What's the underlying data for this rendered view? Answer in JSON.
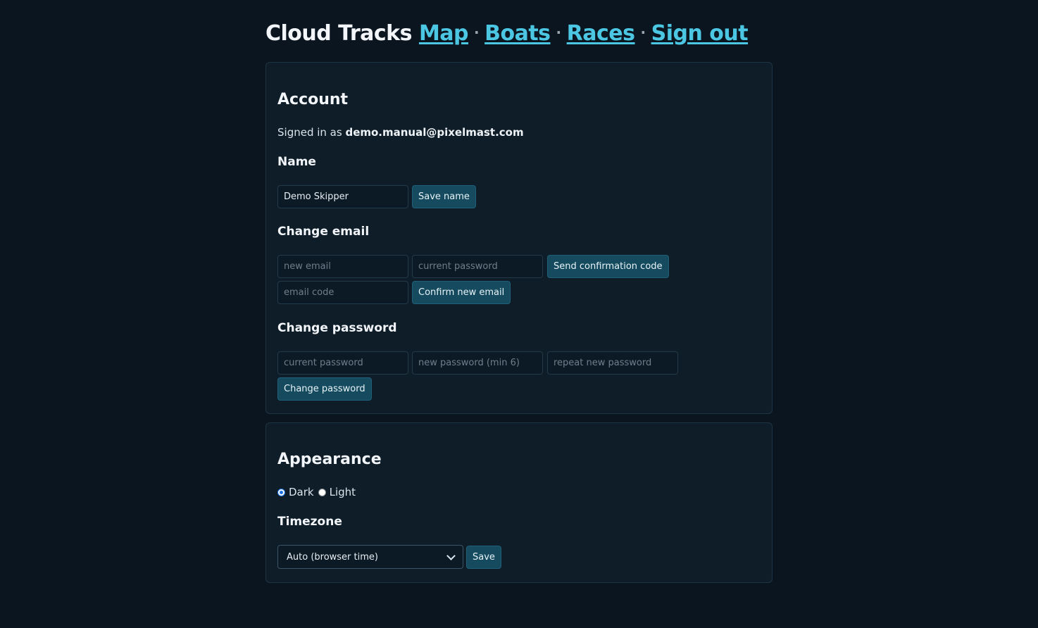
{
  "header": {
    "app_title": "Cloud Tracks",
    "nav": [
      {
        "label": "Map"
      },
      {
        "label": "Boats"
      },
      {
        "label": "Races"
      },
      {
        "label": "Sign out"
      }
    ],
    "separator": "·"
  },
  "account": {
    "title": "Account",
    "signed_in_prefix": "Signed in as ",
    "email": "demo.manual@pixelmast.com",
    "name_section": {
      "title": "Name",
      "name_value": "Demo Skipper",
      "save_label": "Save name"
    },
    "email_section": {
      "title": "Change email",
      "new_email_placeholder": "new email",
      "current_password_placeholder": "current password",
      "send_code_label": "Send confirmation code",
      "email_code_placeholder": "email code",
      "confirm_label": "Confirm new email"
    },
    "password_section": {
      "title": "Change password",
      "current_password_placeholder": "current password",
      "new_password_placeholder": "new password (min 6)",
      "repeat_password_placeholder": "repeat new password",
      "change_label": "Change password"
    }
  },
  "appearance": {
    "title": "Appearance",
    "theme_options": [
      {
        "label": "Dark",
        "selected": true
      },
      {
        "label": "Light",
        "selected": false
      }
    ],
    "timezone": {
      "title": "Timezone",
      "selected": "Auto (browser time)",
      "save_label": "Save"
    }
  }
}
